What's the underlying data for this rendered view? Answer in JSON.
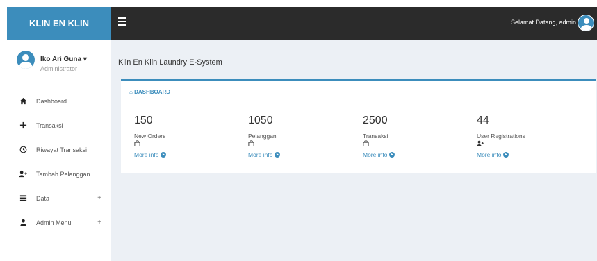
{
  "brand": {
    "title": "KLIN EN KLIN"
  },
  "topbar": {
    "welcome": "Selamat Datang, admin"
  },
  "user": {
    "name": "Iko Ari Guna ▾",
    "role": "Administrator"
  },
  "sidebar": {
    "items": [
      {
        "label": "Dashboard",
        "icon": "home-icon",
        "has_plus": false
      },
      {
        "label": "Transaksi",
        "icon": "plus-icon",
        "has_plus": false
      },
      {
        "label": "Riwayat Transaksi",
        "icon": "clock-icon",
        "has_plus": false
      },
      {
        "label": "Tambah Pelanggan",
        "icon": "user-add-icon",
        "has_plus": false
      },
      {
        "label": "Data",
        "icon": "list-icon",
        "has_plus": true,
        "plus": "+"
      },
      {
        "label": "Admin Menu",
        "icon": "user-icon",
        "has_plus": true,
        "plus": "+"
      }
    ]
  },
  "main": {
    "page_title": "Klin En Klin Laundry E-System",
    "box_title": "DASHBOARD",
    "stats": [
      {
        "value": "150",
        "label": "New Orders",
        "icon": "bag-icon",
        "link": "More info"
      },
      {
        "value": "1050",
        "label": "Pelanggan",
        "icon": "bag-icon",
        "link": "More info"
      },
      {
        "value": "2500",
        "label": "Transaksi",
        "icon": "bag-icon",
        "link": "More info"
      },
      {
        "value": "44",
        "label": "User Registrations",
        "icon": "user-add-icon",
        "link": "More info"
      }
    ]
  },
  "colors": {
    "accent": "#3c8dbc",
    "topbar": "#2b2b2b",
    "background": "#ecf0f5"
  }
}
